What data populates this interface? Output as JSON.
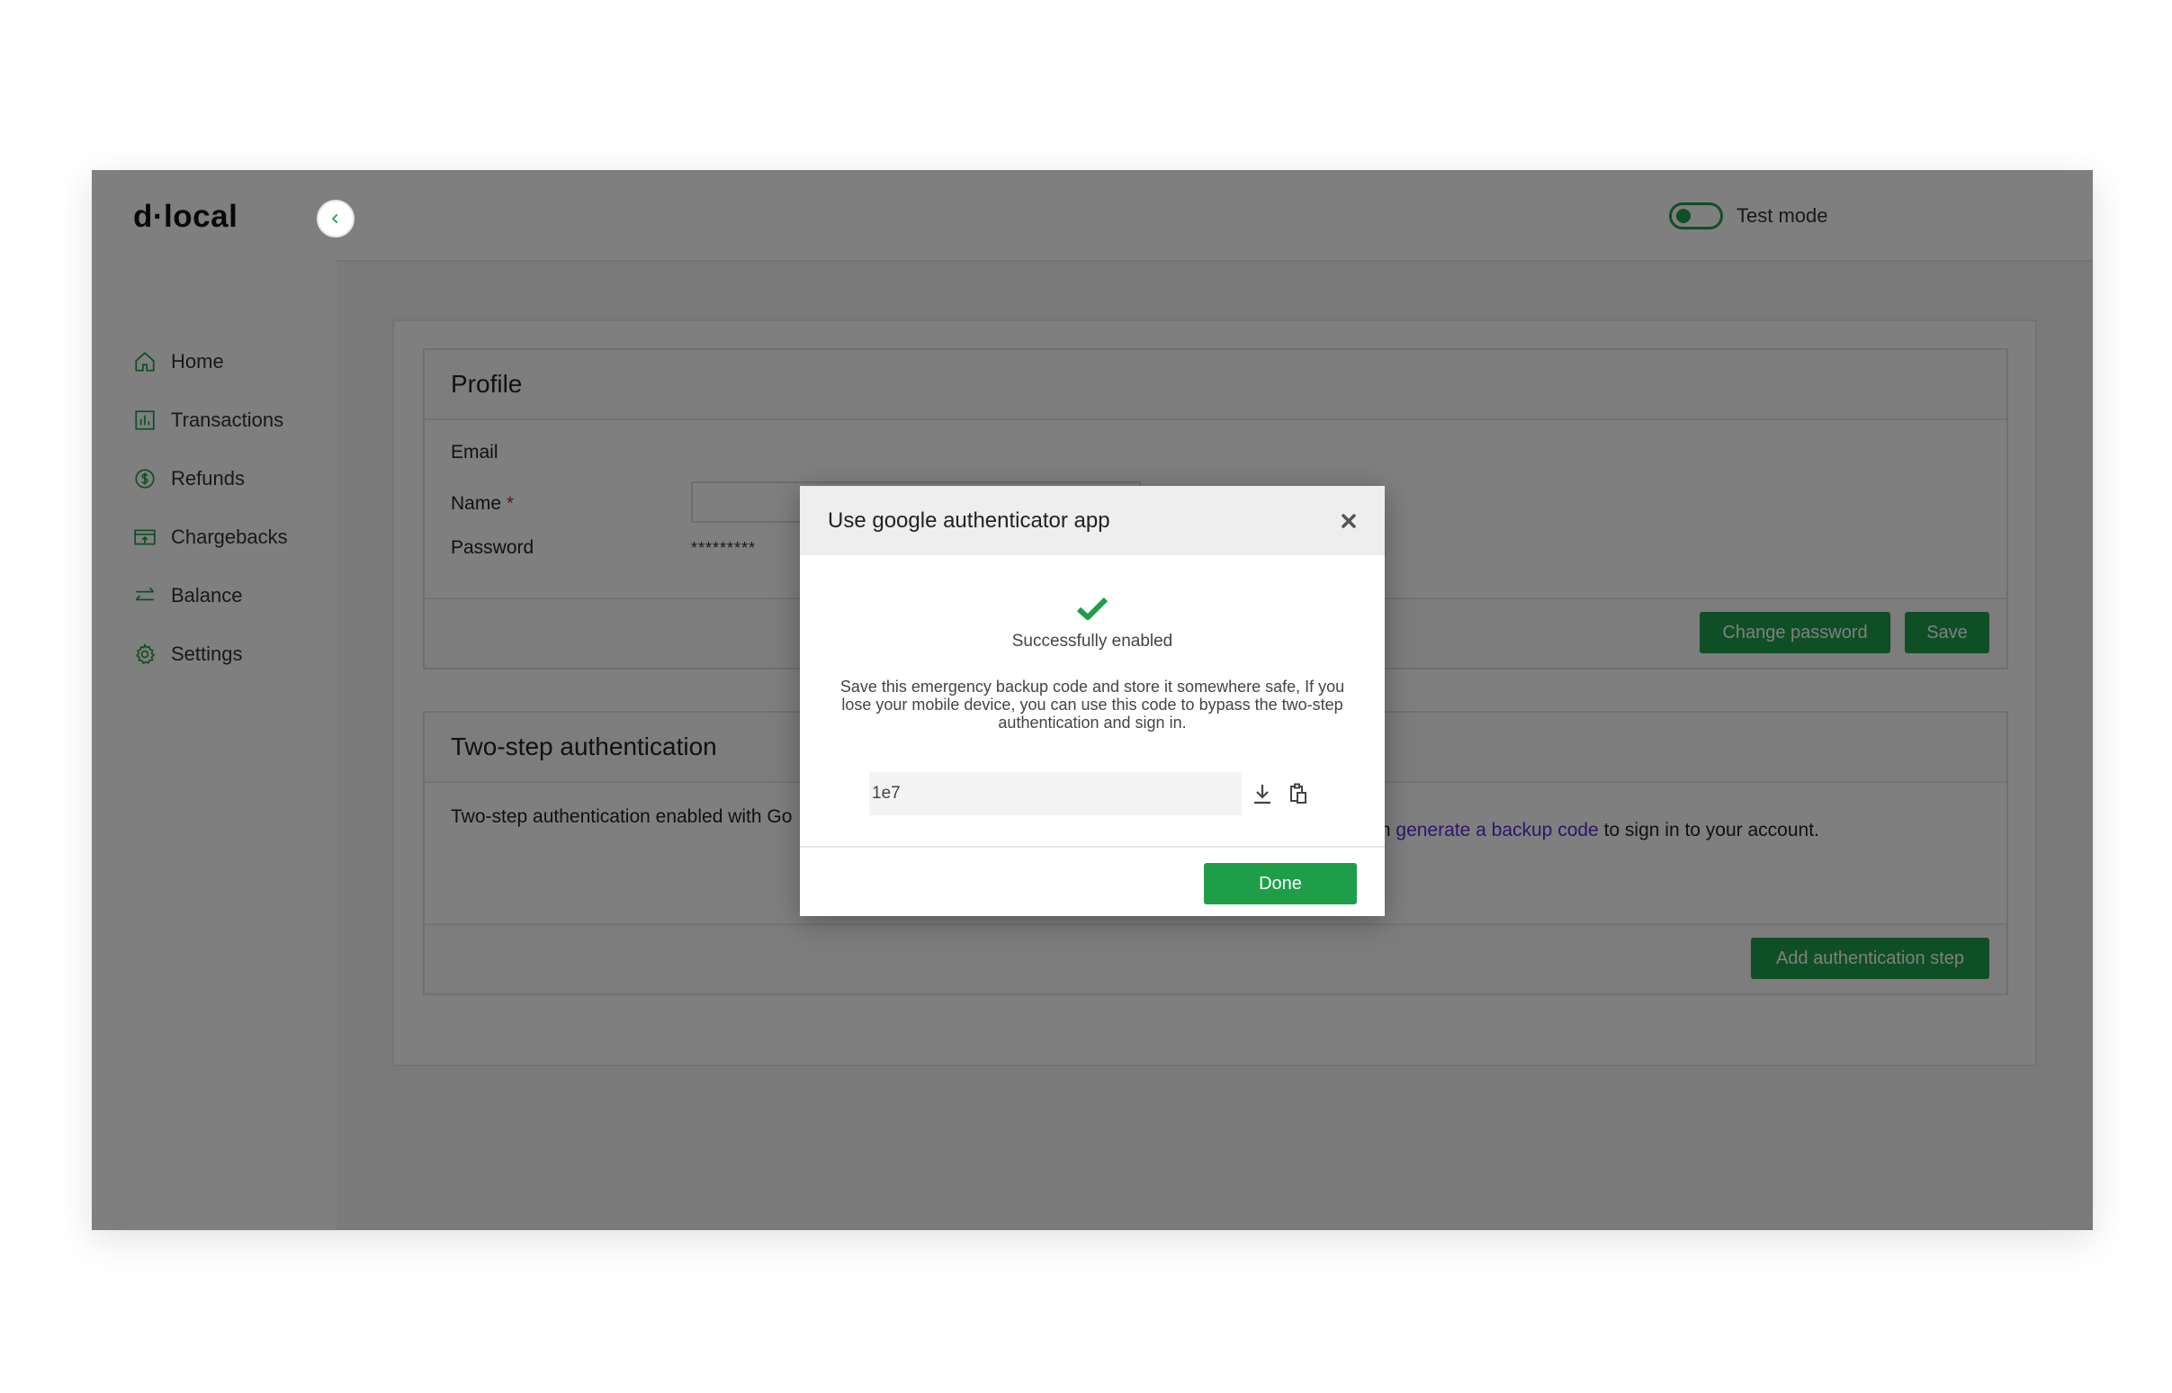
{
  "brand": {
    "logo": "d·local",
    "accent": "#1f9e4a"
  },
  "sidebar": {
    "items": [
      {
        "label": "Home",
        "icon": "home-icon"
      },
      {
        "label": "Transactions",
        "icon": "chart-icon"
      },
      {
        "label": "Refunds",
        "icon": "coin-icon"
      },
      {
        "label": "Chargebacks",
        "icon": "card-icon"
      },
      {
        "label": "Balance",
        "icon": "arrows-icon"
      },
      {
        "label": "Settings",
        "icon": "gear-icon"
      }
    ]
  },
  "topbar": {
    "test_mode_label": "Test mode",
    "test_mode_on": false
  },
  "profile": {
    "title": "Profile",
    "email_label": "Email",
    "name_label": "Name",
    "name_required": "*",
    "password_label": "Password",
    "password_mask": "*********",
    "change_password_label": "Change password",
    "save_label": "Save"
  },
  "two_step": {
    "title": "Two-step authentication",
    "text_left": "Two-step authentication enabled with Go",
    "text_right_prefix": "you can ",
    "link_label": "generate a backup code",
    "text_right_suffix": " to sign in to your account.",
    "add_step_label": "Add authentication step"
  },
  "modal": {
    "title": "Use google authenticator app",
    "success": "Successfully enabled",
    "message": "Save this emergency backup code and store it somewhere safe, If you lose your mobile device, you can use this code to bypass the two-step authentication and sign in.",
    "code": "1e7",
    "done_label": "Done"
  }
}
